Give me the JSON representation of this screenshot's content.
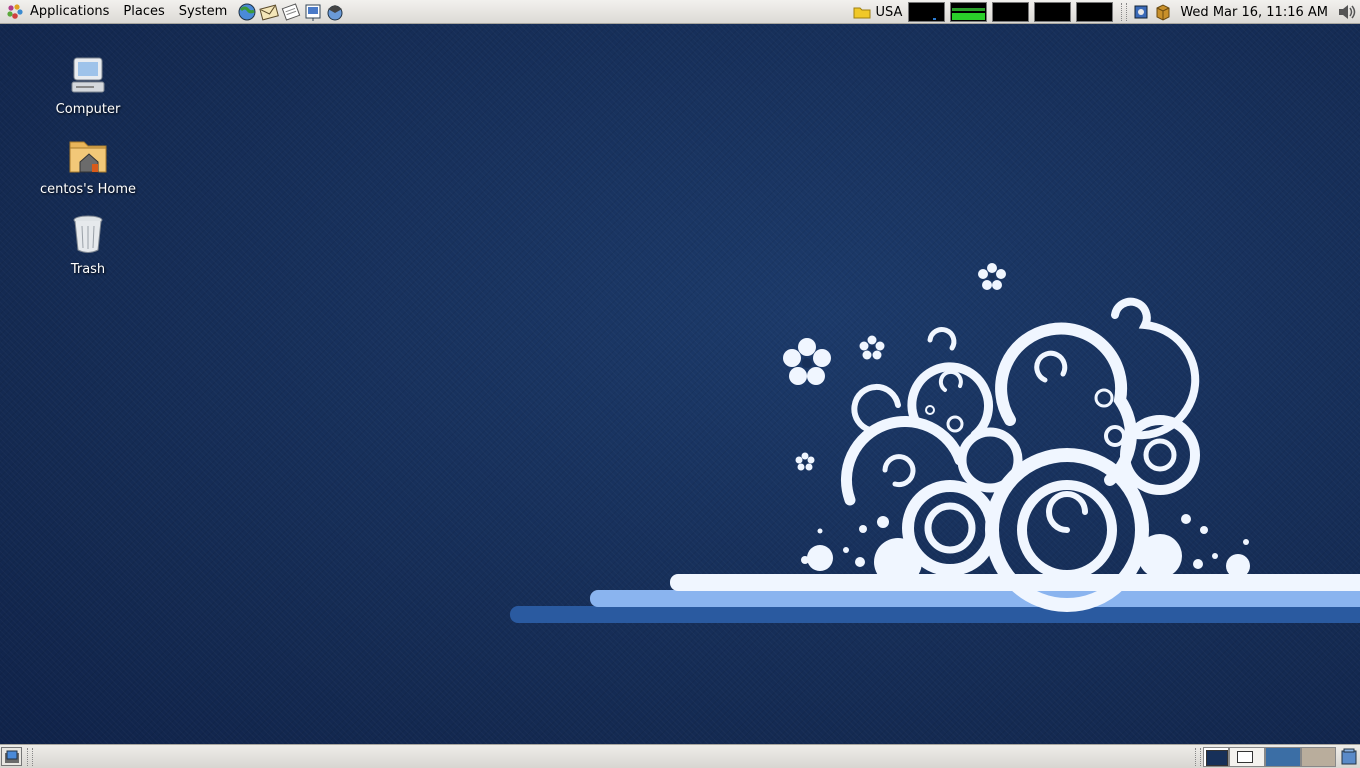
{
  "top_panel": {
    "menus": {
      "applications": "Applications",
      "places": "Places",
      "system": "System"
    },
    "launchers": [
      "web-browser-icon",
      "email-icon",
      "notes-icon",
      "presentation-icon",
      "help-icon"
    ],
    "keyboard_layout": "USA",
    "clock": "Wed Mar 16, 11:16 AM"
  },
  "desktop": {
    "icons": {
      "computer": "Computer",
      "home": "centos's Home",
      "trash": "Trash"
    }
  },
  "colors": {
    "panel": "#dcdad5",
    "desktop": "#173059",
    "workspace_active": "#3b6ea5",
    "workspace_inactive": "#b9ad9c"
  }
}
